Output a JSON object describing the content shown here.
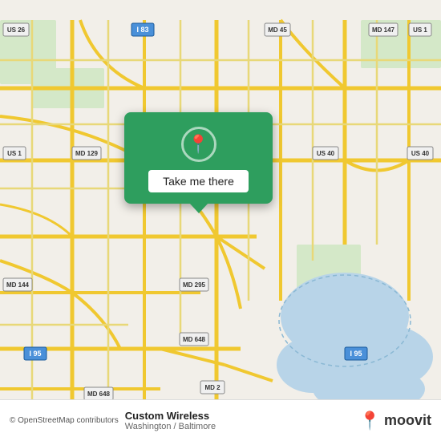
{
  "map": {
    "background_color": "#f2efe9",
    "attribution": "© OpenStreetMap contributors",
    "center_city": "Baltimore",
    "water_color": "#b8d4e8",
    "green_color": "#c8dfc8",
    "road_color": "#f7dc6f",
    "highway_color": "#f7c948"
  },
  "popup": {
    "background_color": "#2e9e5e",
    "button_label": "Take me there",
    "icon": "📍"
  },
  "footer": {
    "attribution": "© OpenStreetMap contributors",
    "title": "Custom Wireless",
    "subtitle": "Washington / Baltimore",
    "logo_text": "moovit",
    "logo_pin_color": "#e8503a"
  }
}
